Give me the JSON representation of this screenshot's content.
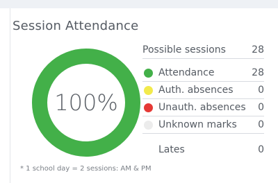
{
  "card": {
    "title": "Session Attendance",
    "percent_label": "100%",
    "attendance_fraction": 1.0,
    "colors": {
      "ring": "#43b049",
      "attendance": "#43b049",
      "auth_absences": "#f2ea4c",
      "unauth_absences": "#e53935",
      "unknown_marks": "#ececec"
    },
    "possible": {
      "label": "Possible sessions",
      "value": "28"
    },
    "rows": [
      {
        "label": "Attendance",
        "value": "28"
      },
      {
        "label": "Auth. absences",
        "value": "0"
      },
      {
        "label": "Unauth. absences",
        "value": "0"
      },
      {
        "label": "Unknown marks",
        "value": "0"
      }
    ],
    "lates": {
      "label": "Lates",
      "value": "0"
    },
    "footnote": "* 1 school day = 2 sessions: AM & PM"
  }
}
